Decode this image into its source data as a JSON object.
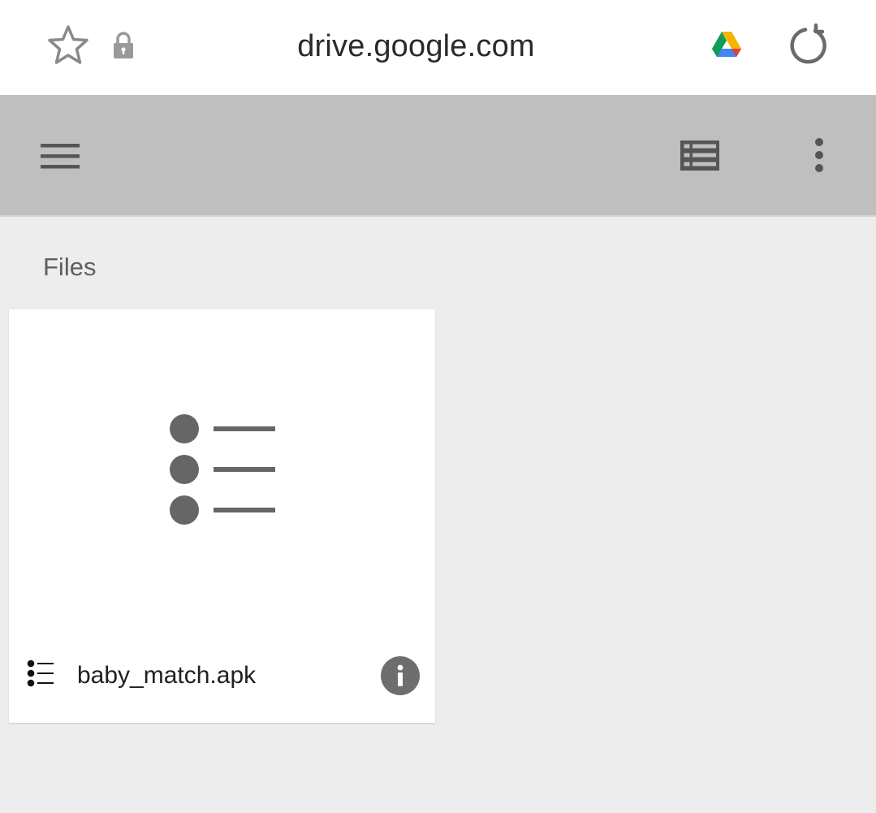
{
  "browser": {
    "url": "drive.google.com",
    "icons": {
      "bookmark": "star-icon",
      "secure": "lock-icon",
      "site": "google-drive-icon",
      "reload": "reload-icon"
    }
  },
  "toolbar": {
    "icons": {
      "menu": "hamburger-menu-icon",
      "view_toggle": "list-view-icon",
      "more": "more-vert-icon"
    }
  },
  "main": {
    "section_title": "Files",
    "files": [
      {
        "name": "baby_match.apk",
        "type_icon": "list-bullet-icon",
        "info_icon": "info-icon"
      }
    ]
  },
  "colors": {
    "toolbar_bg": "#bfbfbf",
    "page_bg": "#ededed",
    "icon_dark": "#555555",
    "drive_green": "#0f9d58",
    "drive_yellow": "#f4b400",
    "drive_blue": "#4285f4",
    "drive_red": "#db4437"
  }
}
